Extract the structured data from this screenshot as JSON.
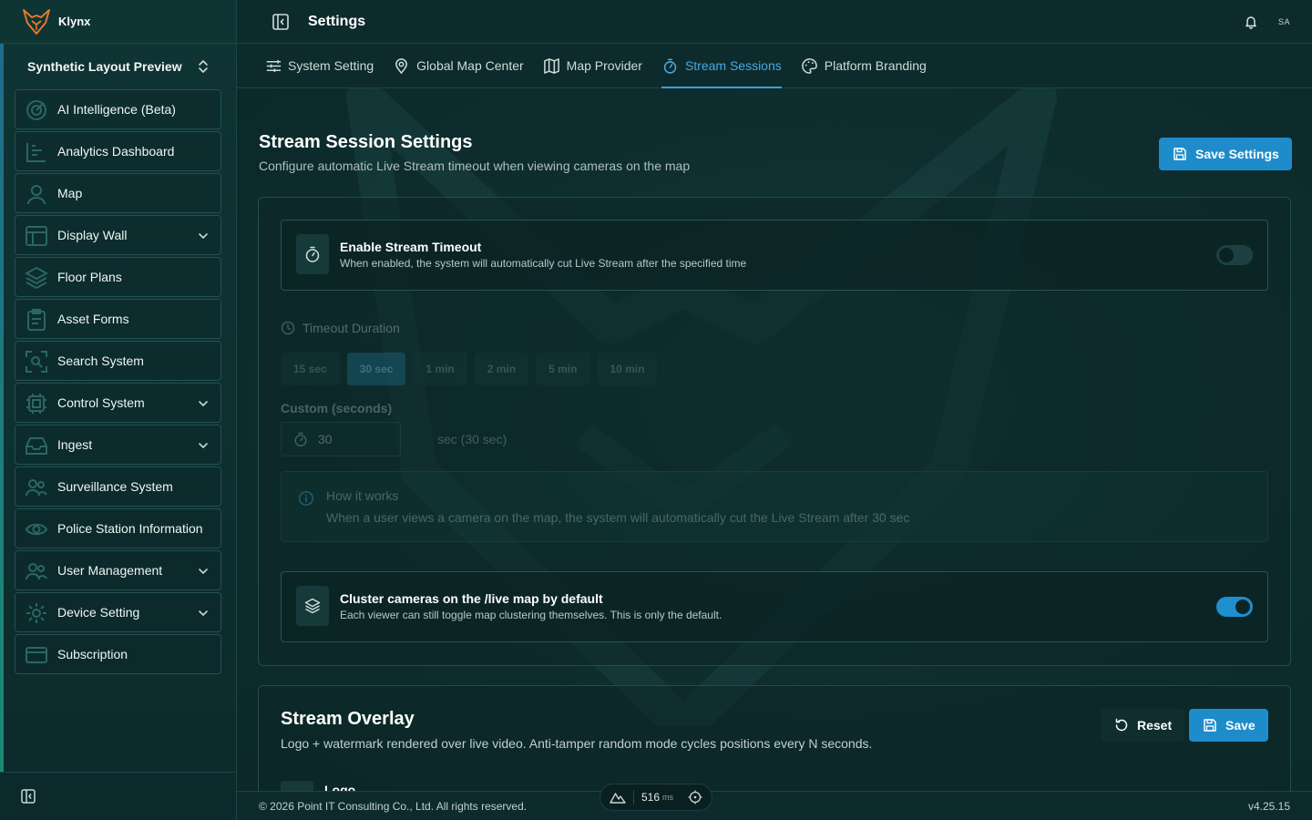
{
  "app": {
    "brand_name": "Klynx",
    "workspace": "Synthetic Layout Preview"
  },
  "sidebar": {
    "items": [
      {
        "label": "AI Intelligence (Beta)",
        "icon": "ai-icon",
        "expandable": false
      },
      {
        "label": "Analytics Dashboard",
        "icon": "chart-icon",
        "expandable": false
      },
      {
        "label": "Map",
        "icon": "map-icon",
        "expandable": false
      },
      {
        "label": "Display Wall",
        "icon": "display-icon",
        "expandable": true
      },
      {
        "label": "Floor Plans",
        "icon": "layers-icon",
        "expandable": false
      },
      {
        "label": "Asset Forms",
        "icon": "clipboard-icon",
        "expandable": false
      },
      {
        "label": "Search System",
        "icon": "scan-icon",
        "expandable": false
      },
      {
        "label": "Control System",
        "icon": "cpu-icon",
        "expandable": true
      },
      {
        "label": "Ingest",
        "icon": "inbox-icon",
        "expandable": true
      },
      {
        "label": "Surveillance System",
        "icon": "users-icon",
        "expandable": false
      },
      {
        "label": "Police Station Information",
        "icon": "eye-icon",
        "expandable": false
      },
      {
        "label": "User Management",
        "icon": "users-icon",
        "expandable": true
      },
      {
        "label": "Device Setting",
        "icon": "gear-icon",
        "expandable": true
      },
      {
        "label": "Subscription",
        "icon": "card-icon",
        "expandable": false
      }
    ]
  },
  "header": {
    "title": "Settings",
    "avatar": "SA"
  },
  "tabs": [
    {
      "label": "System Setting",
      "icon": "sliders-icon",
      "active": false
    },
    {
      "label": "Global Map Center",
      "icon": "map-pin-icon",
      "active": false
    },
    {
      "label": "Map Provider",
      "icon": "map-icon",
      "active": false
    },
    {
      "label": "Stream Sessions",
      "icon": "timer-icon",
      "active": true
    },
    {
      "label": "Platform Branding",
      "icon": "palette-icon",
      "active": false
    }
  ],
  "stream_session": {
    "title": "Stream Session Settings",
    "subtitle": "Configure automatic Live Stream timeout when viewing cameras on the map",
    "save_label": "Save Settings",
    "enable_timeout": {
      "title": "Enable Stream Timeout",
      "description": "When enabled, the system will automatically cut Live Stream after the specified time",
      "enabled": false
    },
    "timeout_label": "Timeout Duration",
    "presets": [
      "15 sec",
      "30 sec",
      "1 min",
      "2 min",
      "5 min",
      "10 min"
    ],
    "selected_preset": "30 sec",
    "custom_label": "Custom (seconds)",
    "custom_value": "30",
    "custom_hint": "sec (30 sec)",
    "how_it_works_title": "How it works",
    "how_it_works_text": "When a user views a camera on the map, the system will automatically cut the Live Stream after 30 sec",
    "cluster": {
      "title": "Cluster cameras on the /live map by default",
      "description": "Each viewer can still toggle map clustering themselves. This is only the default.",
      "enabled": true
    }
  },
  "stream_overlay": {
    "title": "Stream Overlay",
    "subtitle": "Logo + watermark rendered over live video. Anti-tamper random mode cycles positions every N seconds.",
    "reset_label": "Reset",
    "save_label": "Save",
    "logo_label": "Logo"
  },
  "footer": {
    "copyright": "© 2026 Point IT Consulting Co., Ltd. All rights reserved.",
    "version": "v4.25.15",
    "latency_value": "516",
    "latency_unit": "ms"
  },
  "colors": {
    "accent": "#1e8ccb",
    "active_tab": "#4aa8df",
    "background": "#0d2a2b"
  }
}
